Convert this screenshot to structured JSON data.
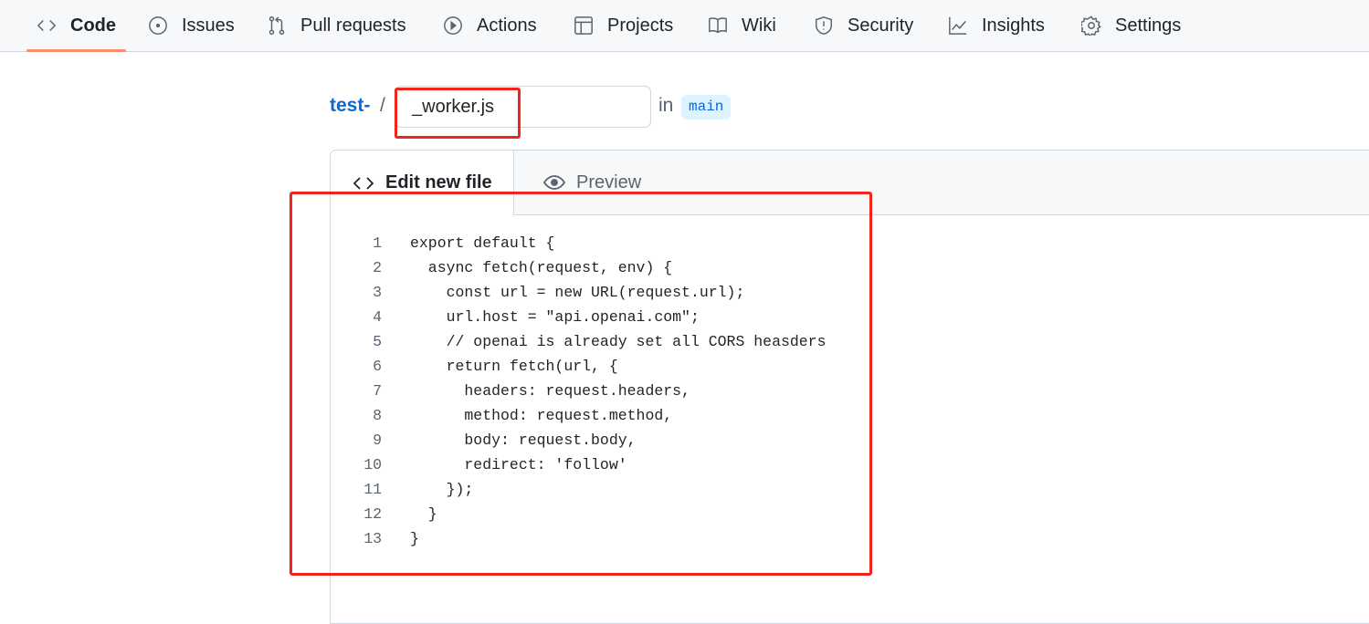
{
  "nav": {
    "items": [
      {
        "label": "Code",
        "icon": "code-icon",
        "active": true
      },
      {
        "label": "Issues",
        "icon": "issue-circle-icon"
      },
      {
        "label": "Pull requests",
        "icon": "pull-request-icon"
      },
      {
        "label": "Actions",
        "icon": "play-icon"
      },
      {
        "label": "Projects",
        "icon": "table-icon"
      },
      {
        "label": "Wiki",
        "icon": "book-icon"
      },
      {
        "label": "Security",
        "icon": "shield-icon"
      },
      {
        "label": "Insights",
        "icon": "graph-icon"
      },
      {
        "label": "Settings",
        "icon": "gear-icon"
      }
    ],
    "active_color": "#fd8c73"
  },
  "breadcrumb": {
    "repo": "test-",
    "separator": "/",
    "filename": "_worker.js",
    "in_label": "in",
    "branch": "main"
  },
  "editor": {
    "tabs": {
      "edit": "Edit new file",
      "preview": "Preview"
    },
    "lines": [
      {
        "n": "1",
        "text": "export default {"
      },
      {
        "n": "2",
        "text": "  async fetch(request, env) {"
      },
      {
        "n": "3",
        "text": "    const url = new URL(request.url);"
      },
      {
        "n": "4",
        "text": "    url.host = \"api.openai.com\";"
      },
      {
        "n": "5",
        "text": "    // openai is already set all CORS heasders"
      },
      {
        "n": "6",
        "text": "    return fetch(url, {"
      },
      {
        "n": "7",
        "text": "      headers: request.headers,"
      },
      {
        "n": "8",
        "text": "      method: request.method,"
      },
      {
        "n": "9",
        "text": "      body: request.body,"
      },
      {
        "n": "10",
        "text": "      redirect: 'follow'"
      },
      {
        "n": "11",
        "text": "    });"
      },
      {
        "n": "12",
        "text": "  }"
      },
      {
        "n": "13",
        "text": "}"
      }
    ]
  },
  "annotation_color": "#f0241a"
}
